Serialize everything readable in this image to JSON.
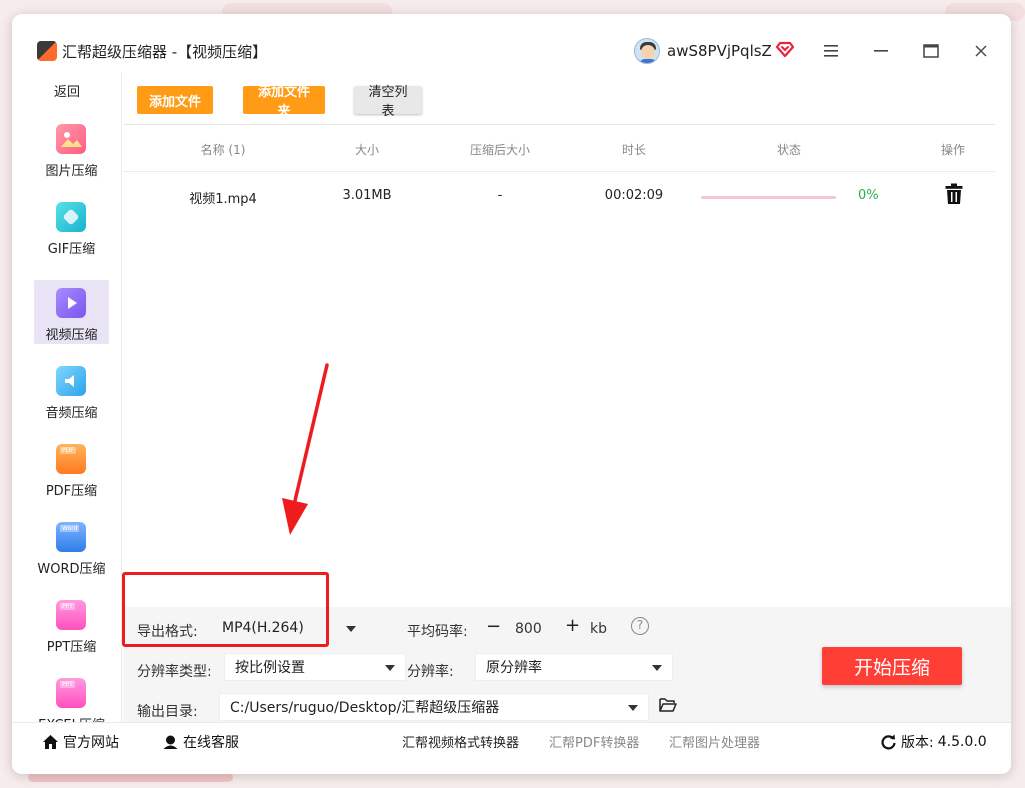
{
  "window": {
    "title": "汇帮超级压缩器  -【视频压缩】",
    "username": "awS8PVjPqlsZ",
    "icons": [
      "app-logo-icon",
      "avatar",
      "vip-heart-icon",
      "menu-icon",
      "minimize-icon",
      "maximize-icon",
      "close-icon"
    ]
  },
  "sidebar": {
    "back": "返回",
    "items": [
      {
        "label": "图片压缩",
        "icon": "image-icon",
        "color": "#ff6f91"
      },
      {
        "label": "GIF压缩",
        "icon": "gif-icon",
        "color": "#22c3d6"
      },
      {
        "label": "视频压缩",
        "icon": "video-icon",
        "color": "#8d6cf5",
        "active": true
      },
      {
        "label": "音频压缩",
        "icon": "audio-icon",
        "color": "#3fb8f0"
      },
      {
        "label": "PDF压缩",
        "icon": "pdf-icon",
        "color": "#ff8a2b",
        "badge": "PDF"
      },
      {
        "label": "WORD压缩",
        "icon": "word-icon",
        "color": "#3b8af0",
        "badge": "Word"
      },
      {
        "label": "PPT压缩",
        "icon": "ppt-icon",
        "color": "#ff5fc2",
        "badge": "PPT"
      },
      {
        "label": "EXCEL压缩",
        "icon": "excel-icon",
        "color": "#ff5fc2",
        "badge": "PPT"
      }
    ]
  },
  "toolbar": {
    "add_file": "添加文件",
    "add_folder": "添加文件夹",
    "clear_list": "清空列表"
  },
  "table": {
    "headers": [
      "名称 (1)",
      "大小",
      "压缩后大小",
      "时长",
      "状态",
      "操作"
    ],
    "rows": [
      {
        "name": "视频1.mp4",
        "size": "3.01MB",
        "compressed_size": "-",
        "duration": "00:02:09",
        "progress": 0,
        "percent": "0%"
      }
    ]
  },
  "settings": {
    "format_label": "导出格式:",
    "format_value": "MP4(H.264)",
    "bitrate_label": "平均码率:",
    "bitrate_value": "800",
    "bitrate_unit": "kb",
    "minus": "−",
    "plus": "+",
    "help": "?",
    "res_type_label": "分辨率类型:",
    "res_type_value": "按比例设置",
    "res_label": "分辨率:",
    "res_value": "原分辨率",
    "output_label": "输出目录:",
    "output_value": "C:/Users/ruguo/Desktop/汇帮超级压缩器",
    "start_button": "开始压缩"
  },
  "footer": {
    "website": "官方网站",
    "support": "在线客服",
    "link1": "汇帮视频格式转换器",
    "link2": "汇帮PDF转换器",
    "link3": "汇帮图片处理器",
    "version_label": "版本:",
    "version": "4.5.0.0"
  },
  "colors": {
    "accent_orange": "#ff9b14",
    "start_red": "#ff3e36",
    "highlight_red": "#ee1c1c",
    "progress_green": "#2bb24c"
  }
}
